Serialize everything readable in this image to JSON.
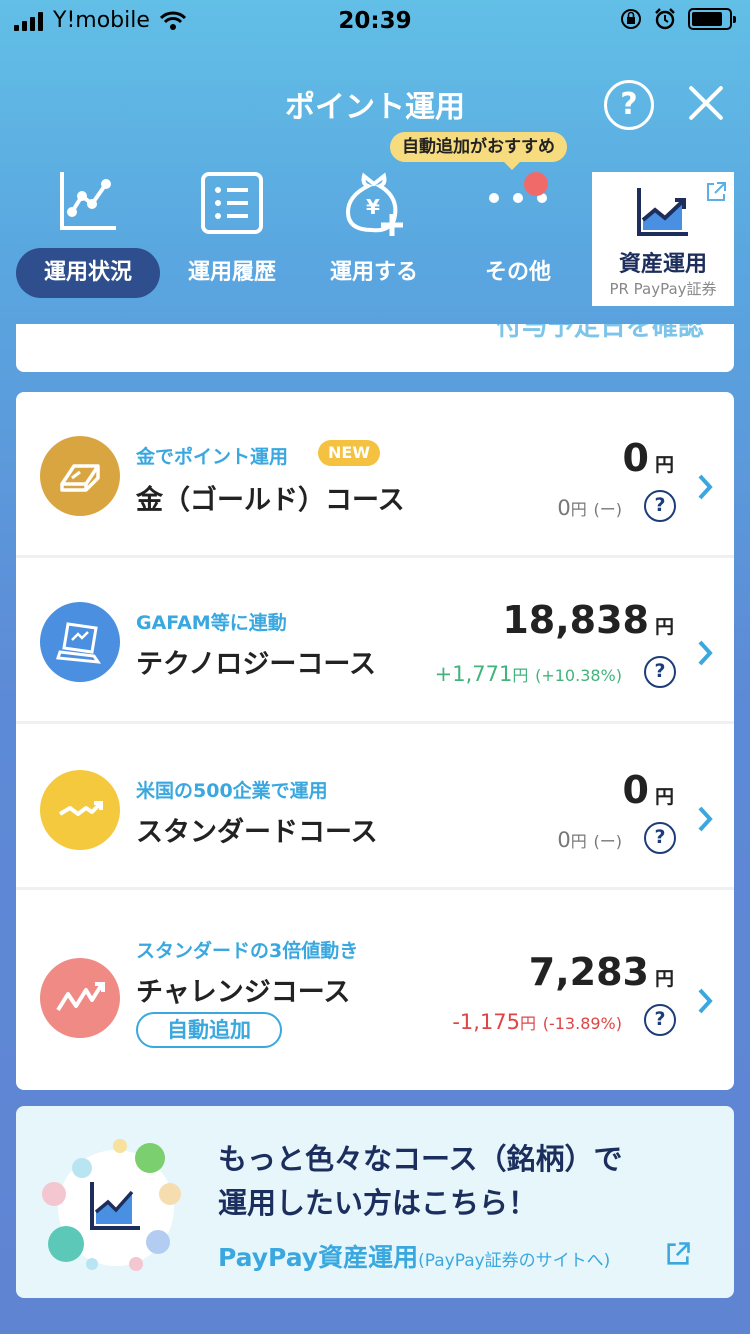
{
  "status": {
    "carrier": "Y!mobile",
    "time": "20:39"
  },
  "header": {
    "title": "ポイント運用",
    "help": "?",
    "recommend": "自動追加がおすすめ"
  },
  "nav": [
    {
      "label": "運用状況",
      "icon": "chart-line-icon"
    },
    {
      "label": "運用履歴",
      "icon": "list-icon"
    },
    {
      "label": "運用する",
      "icon": "money-bag-add-icon"
    },
    {
      "label": "その他",
      "icon": "more-dots-icon"
    }
  ],
  "pr": {
    "name": "資産運用",
    "sub": "PR PayPay証券"
  },
  "top_card": {
    "text": "付与予定日を確認"
  },
  "courses": [
    {
      "tag": "金でポイント運用",
      "badge": "NEW",
      "name": "金（ゴールド）コース",
      "amount": "0",
      "unit": "円",
      "diff": "0",
      "diff_unit": "円",
      "pct": "(ー)",
      "trend": "neutral",
      "color": "#d9a540",
      "icon": "gold-bar-icon"
    },
    {
      "tag": "GAFAM等に連動",
      "name": "テクノロジーコース",
      "amount": "18,838",
      "unit": "円",
      "diff": "+1,771",
      "diff_unit": "円",
      "pct": "(+10.38%)",
      "trend": "up",
      "color": "#4a8fe0",
      "icon": "laptop-icon"
    },
    {
      "tag": "米国の500企業で運用",
      "name": "スタンダードコース",
      "amount": "0",
      "unit": "円",
      "diff": "0",
      "diff_unit": "円",
      "pct": "(ー)",
      "trend": "neutral",
      "color": "#f5c93e",
      "icon": "trend-up-icon"
    },
    {
      "tag": "スタンダードの3倍値動き",
      "name": "チャレンジコース",
      "badge": "自動追加",
      "amount": "7,283",
      "unit": "円",
      "diff": "-1,175",
      "diff_unit": "円",
      "pct": "(-13.89%)",
      "trend": "down",
      "color": "#ef8a85",
      "icon": "zigzag-up-icon"
    }
  ],
  "promo": {
    "line1": "もっと色々なコース（銘柄）で",
    "line2": "運用したい方はこちら！",
    "link": "PayPay資産運用",
    "link_sub": "(PayPay証券のサイトへ)"
  }
}
